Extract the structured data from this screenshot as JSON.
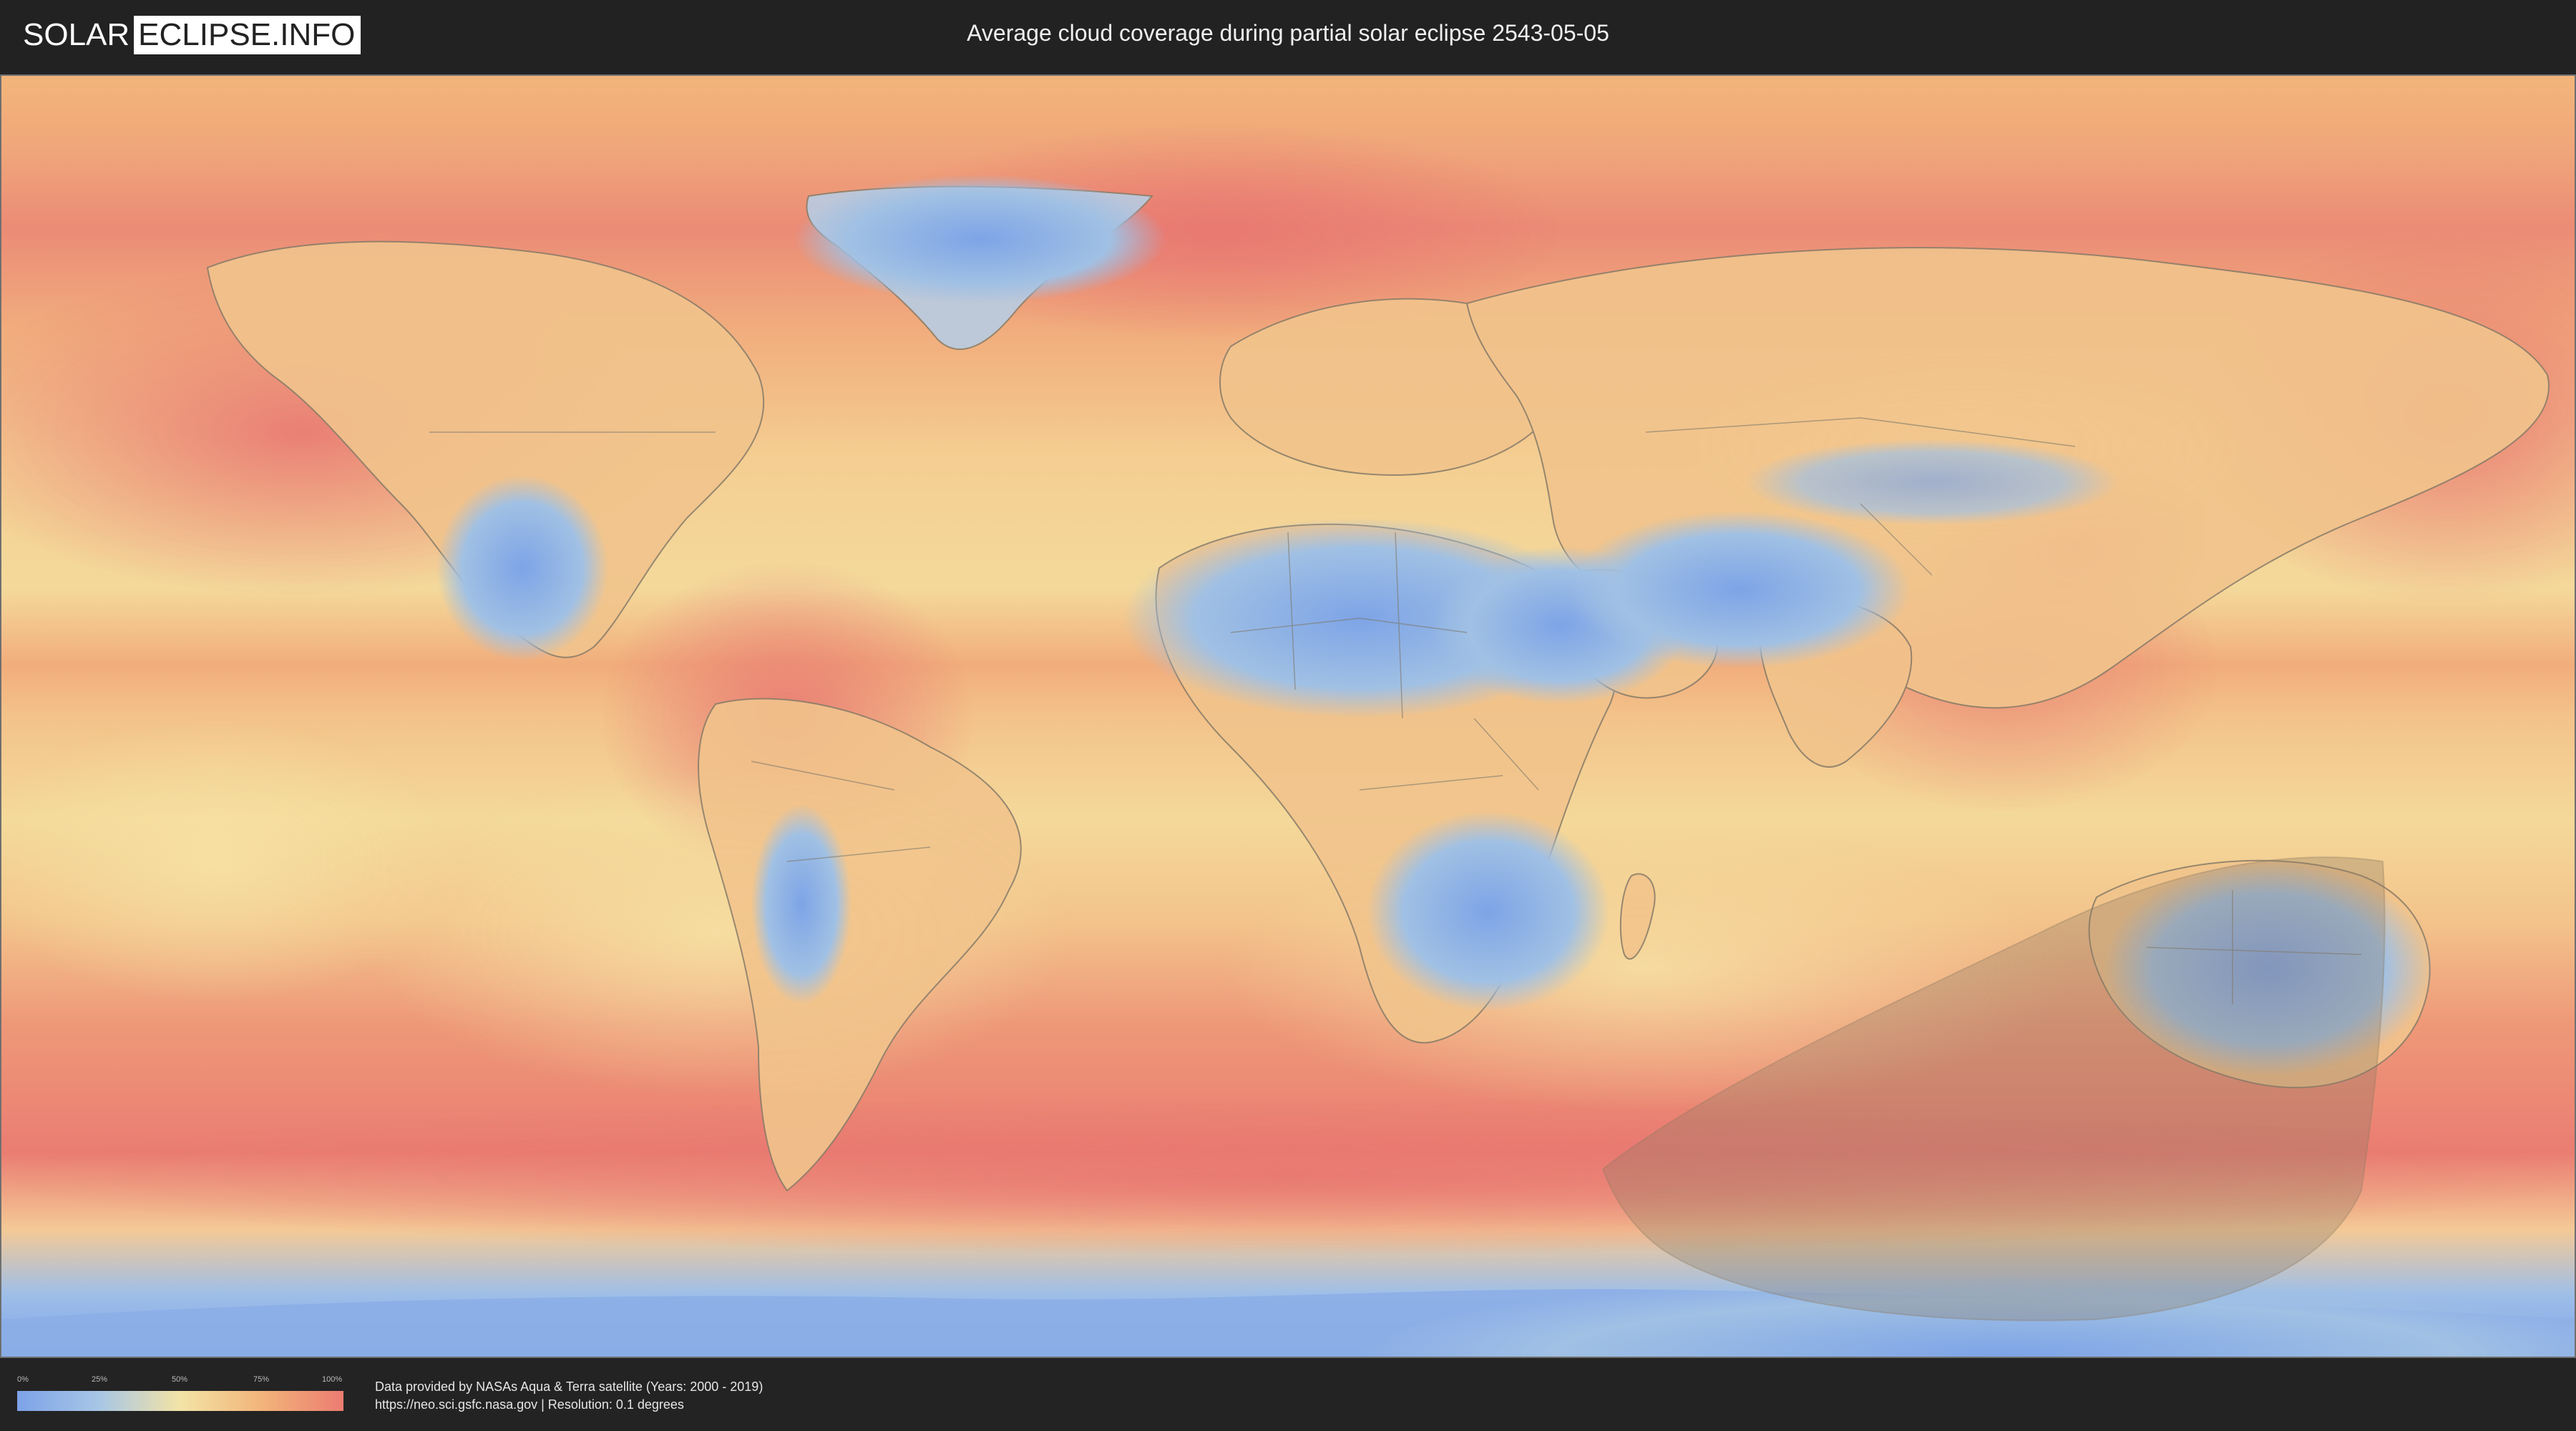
{
  "header": {
    "logo_solar": "SOLAR",
    "logo_eclipse": "ECLIPSE.INFO",
    "title": "Average cloud coverage during partial solar eclipse 2543-05-05"
  },
  "legend": {
    "ticks": [
      "0%",
      "25%",
      "50%",
      "75%",
      "100%"
    ],
    "gradient_colors": [
      "#7da2e8",
      "#a7c6e6",
      "#f3e3a6",
      "#f2b479",
      "#ec7c72"
    ]
  },
  "credits": {
    "line1": "Data provided by NASAs Aqua & Terra satellite (Years: 2000 - 2019)",
    "line2": "https://neo.sci.gsfc.nasa.gov | Resolution: 0.1 degrees"
  },
  "map": {
    "colors": {
      "clear": "#7ea6e6",
      "low": "#b6cfe3",
      "mid": "#f3dd9c",
      "high": "#f3ad7a",
      "overcast": "#ea7f74",
      "eclipse_shadow": "#8c7a62",
      "border_line": "#6b6a60"
    }
  }
}
